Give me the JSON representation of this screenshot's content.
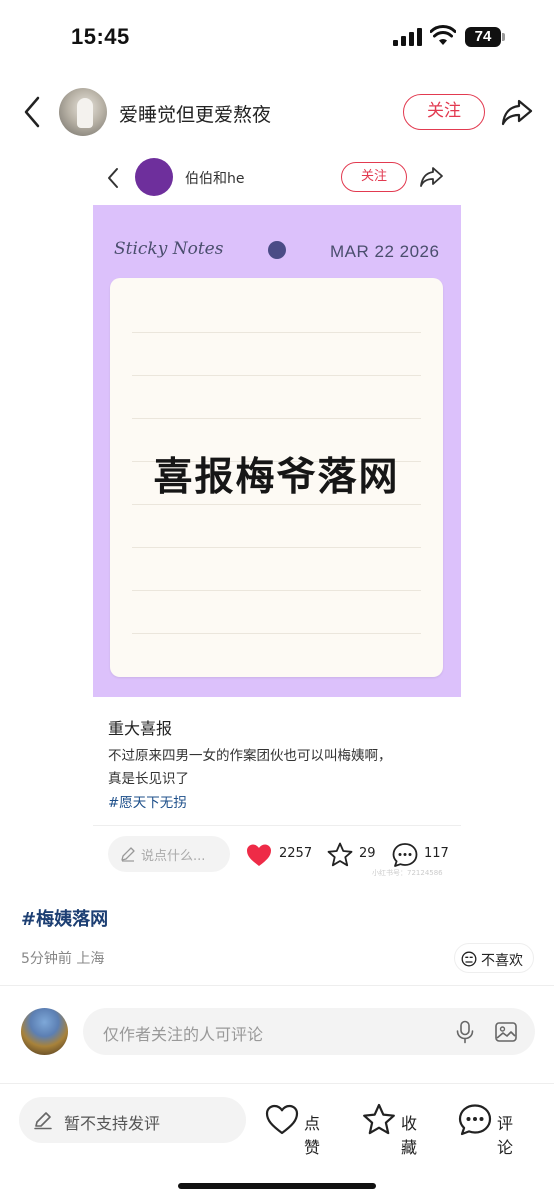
{
  "status_bar": {
    "time": "15:45",
    "battery": "74"
  },
  "header": {
    "author_name": "爱睡觉但更爱熬夜",
    "follow_label": "关注"
  },
  "embedded_post": {
    "author_name": "伯伯和he",
    "follow_label": "关注",
    "note": {
      "brand": "Sticky Notes",
      "date": "MAR 22 2026",
      "text": "喜报梅爷落网",
      "background_color": "#dcc1fb"
    },
    "title": "重大喜报",
    "body_line1": "不过原来四男一女的作案团伙也可以叫梅姨啊，",
    "body_line2": "真是长见识了",
    "hashtag": "#愿天下无拐",
    "comment_placeholder": "说点什么...",
    "likes": "2257",
    "favorites": "29",
    "comments": "117",
    "watermark": "小红书号：72124586"
  },
  "post": {
    "topic": "#梅姨落网",
    "meta": "5分钟前 上海",
    "dislike_label": "不喜欢"
  },
  "comment_box": {
    "placeholder": "仅作者关注的人可评论"
  },
  "bottom_bar": {
    "comment_label": "暂不支持发评",
    "like_label": "点赞",
    "favorite_label": "收藏",
    "comment_action_label": "评论"
  },
  "colors": {
    "accent_red": "#e23a50",
    "hashtag_blue": "#1d4f8a",
    "note_purple": "#dcc1fb"
  }
}
